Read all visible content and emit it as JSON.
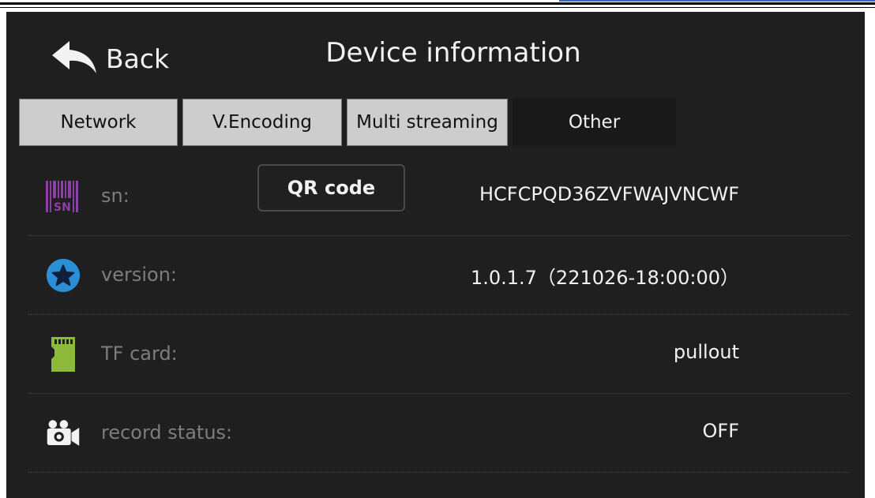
{
  "header": {
    "back_label": "Back",
    "title": "Device information"
  },
  "tabs": [
    {
      "label": "Network",
      "active": false
    },
    {
      "label": "V.Encoding",
      "active": false
    },
    {
      "label": "Multi streaming",
      "active": false
    },
    {
      "label": "Other",
      "active": true
    }
  ],
  "rows": {
    "sn": {
      "label": "sn:",
      "value": "HCFCPQD36ZVFWAJVNCWF",
      "button_label": "QR code",
      "icon": "barcode-sn-icon",
      "icon_text": "SN"
    },
    "version": {
      "label": "version:",
      "value": "1.0.1.7（221026-18:00:00）",
      "icon": "star-icon"
    },
    "tf_card": {
      "label": "TF card:",
      "value": "pullout",
      "icon": "sd-card-icon"
    },
    "record_status": {
      "label": "record status:",
      "value": "OFF",
      "icon": "video-camera-icon"
    }
  },
  "colors": {
    "background": "#1f1f1f",
    "tab_inactive": "#cdcdcd",
    "barcode_purple": "#8e3fa6",
    "star_blue": "#2c8fd6",
    "sd_green": "#8dba3a",
    "label_gray": "#7d7d7d"
  }
}
